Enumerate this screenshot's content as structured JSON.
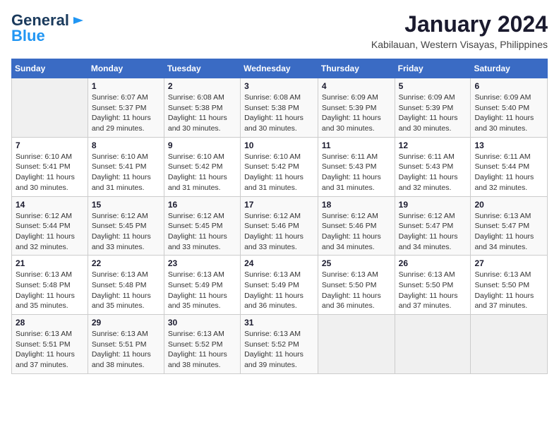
{
  "header": {
    "logo_line1": "General",
    "logo_line2": "Blue",
    "month_year": "January 2024",
    "location": "Kabilauan, Western Visayas, Philippines"
  },
  "days_of_week": [
    "Sunday",
    "Monday",
    "Tuesday",
    "Wednesday",
    "Thursday",
    "Friday",
    "Saturday"
  ],
  "weeks": [
    [
      {
        "day": "",
        "detail": ""
      },
      {
        "day": "1",
        "detail": "Sunrise: 6:07 AM\nSunset: 5:37 PM\nDaylight: 11 hours\nand 29 minutes."
      },
      {
        "day": "2",
        "detail": "Sunrise: 6:08 AM\nSunset: 5:38 PM\nDaylight: 11 hours\nand 30 minutes."
      },
      {
        "day": "3",
        "detail": "Sunrise: 6:08 AM\nSunset: 5:38 PM\nDaylight: 11 hours\nand 30 minutes."
      },
      {
        "day": "4",
        "detail": "Sunrise: 6:09 AM\nSunset: 5:39 PM\nDaylight: 11 hours\nand 30 minutes."
      },
      {
        "day": "5",
        "detail": "Sunrise: 6:09 AM\nSunset: 5:39 PM\nDaylight: 11 hours\nand 30 minutes."
      },
      {
        "day": "6",
        "detail": "Sunrise: 6:09 AM\nSunset: 5:40 PM\nDaylight: 11 hours\nand 30 minutes."
      }
    ],
    [
      {
        "day": "7",
        "detail": "Sunrise: 6:10 AM\nSunset: 5:41 PM\nDaylight: 11 hours\nand 30 minutes."
      },
      {
        "day": "8",
        "detail": "Sunrise: 6:10 AM\nSunset: 5:41 PM\nDaylight: 11 hours\nand 31 minutes."
      },
      {
        "day": "9",
        "detail": "Sunrise: 6:10 AM\nSunset: 5:42 PM\nDaylight: 11 hours\nand 31 minutes."
      },
      {
        "day": "10",
        "detail": "Sunrise: 6:10 AM\nSunset: 5:42 PM\nDaylight: 11 hours\nand 31 minutes."
      },
      {
        "day": "11",
        "detail": "Sunrise: 6:11 AM\nSunset: 5:43 PM\nDaylight: 11 hours\nand 31 minutes."
      },
      {
        "day": "12",
        "detail": "Sunrise: 6:11 AM\nSunset: 5:43 PM\nDaylight: 11 hours\nand 32 minutes."
      },
      {
        "day": "13",
        "detail": "Sunrise: 6:11 AM\nSunset: 5:44 PM\nDaylight: 11 hours\nand 32 minutes."
      }
    ],
    [
      {
        "day": "14",
        "detail": "Sunrise: 6:12 AM\nSunset: 5:44 PM\nDaylight: 11 hours\nand 32 minutes."
      },
      {
        "day": "15",
        "detail": "Sunrise: 6:12 AM\nSunset: 5:45 PM\nDaylight: 11 hours\nand 33 minutes."
      },
      {
        "day": "16",
        "detail": "Sunrise: 6:12 AM\nSunset: 5:45 PM\nDaylight: 11 hours\nand 33 minutes."
      },
      {
        "day": "17",
        "detail": "Sunrise: 6:12 AM\nSunset: 5:46 PM\nDaylight: 11 hours\nand 33 minutes."
      },
      {
        "day": "18",
        "detail": "Sunrise: 6:12 AM\nSunset: 5:46 PM\nDaylight: 11 hours\nand 34 minutes."
      },
      {
        "day": "19",
        "detail": "Sunrise: 6:12 AM\nSunset: 5:47 PM\nDaylight: 11 hours\nand 34 minutes."
      },
      {
        "day": "20",
        "detail": "Sunrise: 6:13 AM\nSunset: 5:47 PM\nDaylight: 11 hours\nand 34 minutes."
      }
    ],
    [
      {
        "day": "21",
        "detail": "Sunrise: 6:13 AM\nSunset: 5:48 PM\nDaylight: 11 hours\nand 35 minutes."
      },
      {
        "day": "22",
        "detail": "Sunrise: 6:13 AM\nSunset: 5:48 PM\nDaylight: 11 hours\nand 35 minutes."
      },
      {
        "day": "23",
        "detail": "Sunrise: 6:13 AM\nSunset: 5:49 PM\nDaylight: 11 hours\nand 35 minutes."
      },
      {
        "day": "24",
        "detail": "Sunrise: 6:13 AM\nSunset: 5:49 PM\nDaylight: 11 hours\nand 36 minutes."
      },
      {
        "day": "25",
        "detail": "Sunrise: 6:13 AM\nSunset: 5:50 PM\nDaylight: 11 hours\nand 36 minutes."
      },
      {
        "day": "26",
        "detail": "Sunrise: 6:13 AM\nSunset: 5:50 PM\nDaylight: 11 hours\nand 37 minutes."
      },
      {
        "day": "27",
        "detail": "Sunrise: 6:13 AM\nSunset: 5:50 PM\nDaylight: 11 hours\nand 37 minutes."
      }
    ],
    [
      {
        "day": "28",
        "detail": "Sunrise: 6:13 AM\nSunset: 5:51 PM\nDaylight: 11 hours\nand 37 minutes."
      },
      {
        "day": "29",
        "detail": "Sunrise: 6:13 AM\nSunset: 5:51 PM\nDaylight: 11 hours\nand 38 minutes."
      },
      {
        "day": "30",
        "detail": "Sunrise: 6:13 AM\nSunset: 5:52 PM\nDaylight: 11 hours\nand 38 minutes."
      },
      {
        "day": "31",
        "detail": "Sunrise: 6:13 AM\nSunset: 5:52 PM\nDaylight: 11 hours\nand 39 minutes."
      },
      {
        "day": "",
        "detail": ""
      },
      {
        "day": "",
        "detail": ""
      },
      {
        "day": "",
        "detail": ""
      }
    ]
  ]
}
